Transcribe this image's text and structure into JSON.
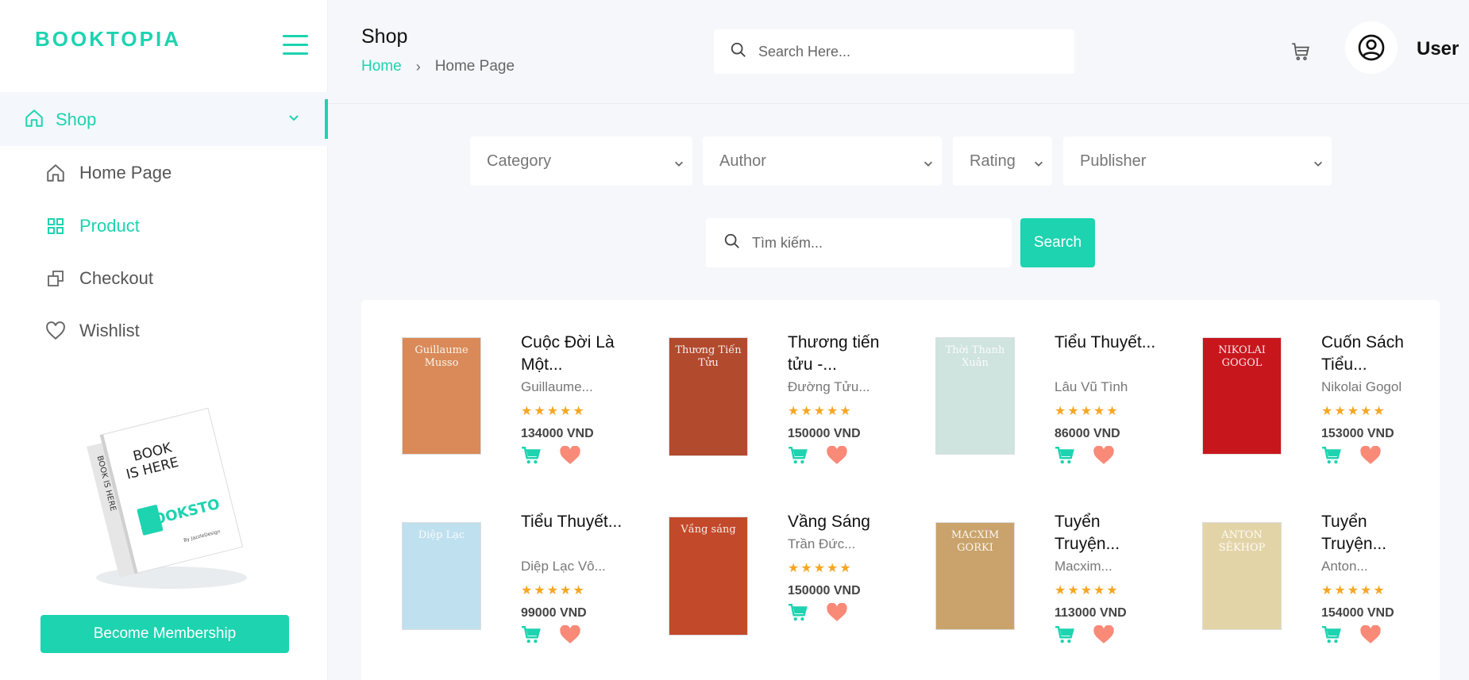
{
  "app": {
    "brand": "BOOKTOPIA"
  },
  "sidebar": {
    "shop_label": "Shop",
    "items": [
      {
        "label": "Home Page",
        "icon": "home-icon"
      },
      {
        "label": "Product",
        "icon": "grid-icon"
      },
      {
        "label": "Checkout",
        "icon": "copy-icon"
      },
      {
        "label": "Wishlist",
        "icon": "heart-outline-icon"
      }
    ],
    "promo": {
      "line1": "BOOK",
      "line2": "IS HERE",
      "logo": "BOOKSTO",
      "spine": "BOOK IS HERE",
      "credit": "By JazzleDesign"
    },
    "member_button": "Become Membership"
  },
  "header": {
    "title": "Shop",
    "breadcrumb": {
      "home": "Home",
      "separator": "›",
      "current": "Home Page"
    },
    "search_placeholder": "Search Here...",
    "user_name": "User"
  },
  "filters": {
    "category": "Category",
    "author": "Author",
    "rating": "Rating",
    "publisher": "Publisher",
    "search_placeholder": "Tìm kiếm...",
    "search_button": "Search"
  },
  "products": [
    {
      "title": "Cuộc Đời Là Một...",
      "author": "Guillaume...",
      "stars": "★★★★★",
      "price": "134000 VND",
      "cover_color": "#d98a58",
      "cover_text": "Guillaume Musso"
    },
    {
      "title": "Thương tiến tửu -...",
      "author": "Đường Tửu...",
      "stars": "★★★★★",
      "price": "150000 VND",
      "cover_color": "#b24a2e",
      "cover_text": "Thương Tiến Tửu"
    },
    {
      "title": "Tiểu Thuyết...",
      "author": "Lâu Vũ Tình",
      "stars": "★★★★★",
      "price": "86000 VND",
      "cover_color": "#cfe3df",
      "cover_text": "Thời Thanh Xuân"
    },
    {
      "title": "Cuốn Sách Tiểu...",
      "author": "Nikolai Gogol",
      "stars": "★★★★★",
      "price": "153000 VND",
      "cover_color": "#c8161d",
      "cover_text": "NIKOLAI GOGOL"
    },
    {
      "title": "Tiểu Thuyết...",
      "author": "Diệp Lạc Vô...",
      "stars": "★★★★★",
      "price": "99000 VND",
      "cover_color": "#bfe0ee",
      "cover_text": "Diệp Lạc"
    },
    {
      "title": "Vầng Sáng",
      "author": "Trần Đức...",
      "stars": "★★★★★",
      "price": "150000 VND",
      "cover_color": "#c2492a",
      "cover_text": "Vầng sáng"
    },
    {
      "title": "Tuyển Truyện...",
      "author": "Macxim...",
      "stars": "★★★★★",
      "price": "113000 VND",
      "cover_color": "#c9a36b",
      "cover_text": "MACXIM GORKI"
    },
    {
      "title": "Tuyển Truyện...",
      "author": "Anton...",
      "stars": "★★★★★",
      "price": "154000 VND",
      "cover_color": "#e3d4a8",
      "cover_text": "ANTON SÊKHOP"
    }
  ],
  "colors": {
    "accent": "#1dd3b0",
    "heart": "#f98a78",
    "star": "#f6a623"
  }
}
